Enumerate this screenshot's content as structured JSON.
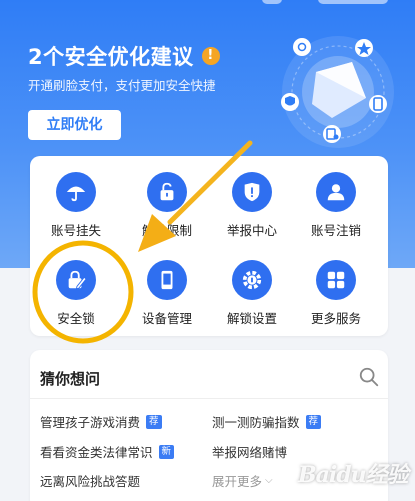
{
  "hero": {
    "title": "2个安全优化建议",
    "badge": "!",
    "subtitle": "开通刷脸支付，支付更加安全快捷",
    "optimize_label": "立即优化"
  },
  "services": [
    {
      "label": "账号挂失",
      "icon": "umbrella-icon"
    },
    {
      "label": "解除限制",
      "icon": "unlock-icon"
    },
    {
      "label": "举报中心",
      "icon": "report-shield-icon"
    },
    {
      "label": "账号注销",
      "icon": "person-icon"
    },
    {
      "label": "安全锁",
      "icon": "lock-edit-icon"
    },
    {
      "label": "设备管理",
      "icon": "phone-icon"
    },
    {
      "label": "解锁设置",
      "icon": "gear-icon"
    },
    {
      "label": "更多服务",
      "icon": "grid-icon"
    }
  ],
  "guess": {
    "title": "猜你想问",
    "questions": [
      {
        "text": "管理孩子游戏消费",
        "tag": "荐"
      },
      {
        "text": "测一测防骗指数",
        "tag": "荐"
      },
      {
        "text": "看看资金类法律常识",
        "tag": "新"
      },
      {
        "text": "举报网络赌博",
        "tag": ""
      },
      {
        "text": "远离风险挑战答题",
        "tag": ""
      }
    ],
    "expand_label": "展开更多"
  },
  "colors": {
    "brand_blue": "#2f7df6",
    "icon_blue": "#2f6ff0",
    "warning": "#f5a524",
    "highlight": "#f4b400"
  },
  "watermark": "Baidu经验"
}
